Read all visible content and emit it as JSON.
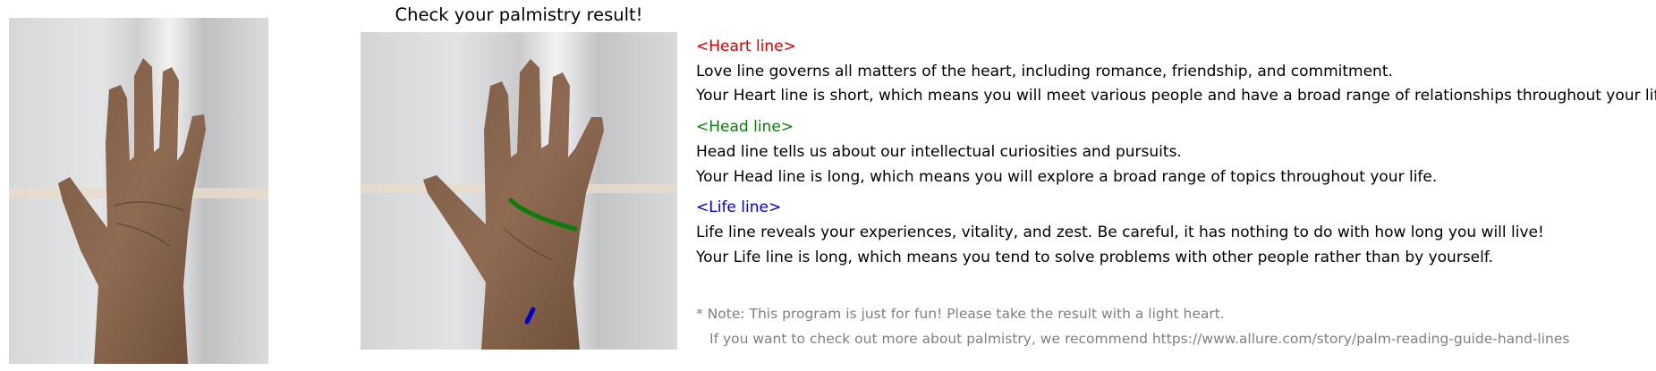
{
  "title": "Check your palmistry result!",
  "sections": [
    {
      "header": "<Heart line>",
      "color": "#d40000",
      "description": "Love line governs all matters of the heart, including romance, friendship, and commitment.",
      "result": "Your Heart line is short, which means you will meet various people and have a broad range of relationships throughout your life."
    },
    {
      "header": "<Head line>",
      "color": "#0a7d0a",
      "description": "Head line tells us about our intellectual curiosities and pursuits.",
      "result": "Your Head line is long, which means you will explore a broad range of topics throughout your life."
    },
    {
      "header": "<Life line>",
      "color": "#0000cc",
      "description": "Life line reveals your experiences, vitality, and zest. Be careful, it has nothing to do with how long you will live!",
      "result": "Your Life line is long, which means you tend to solve problems with other people rather than by yourself."
    }
  ],
  "note_line1": "* Note: This program is just for fun! Please take the result with a light heart.",
  "note_line2": "If you want to check out more about palmistry, we recommend https://www.allure.com/story/palm-reading-guide-hand-lines",
  "colors": {
    "heart": "#d40000",
    "head": "#0a7d0a",
    "life": "#0000cc",
    "note": "#808080"
  }
}
